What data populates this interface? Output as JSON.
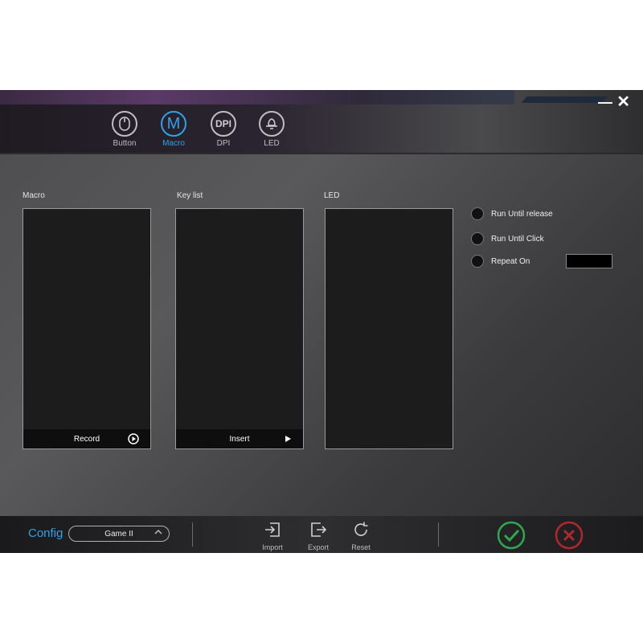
{
  "window": {
    "minimize_symbol": "—",
    "close_symbol": "✕"
  },
  "nav": {
    "tabs": [
      {
        "label": "Button",
        "icon": "mouse-icon",
        "active": false
      },
      {
        "label": "Macro",
        "icon_text": "M",
        "active": true
      },
      {
        "label": "DPI",
        "icon_text": "DPI",
        "active": false
      },
      {
        "label": "LED",
        "icon": "led-icon",
        "active": false
      }
    ]
  },
  "panels": {
    "macro": {
      "title": "Macro",
      "footer_label": "Record",
      "footer_icon": "play-circle-icon"
    },
    "keylist": {
      "title": "Key list",
      "footer_label": "Insert",
      "footer_icon": "play-icon"
    },
    "led": {
      "title": "LED"
    }
  },
  "options": [
    {
      "label": "Run Until release"
    },
    {
      "label": "Run Until Click"
    },
    {
      "label": "Repeat On"
    }
  ],
  "footer": {
    "config_label": "Config",
    "config_value": "Game II",
    "tools": [
      {
        "label": "Import",
        "icon": "import-icon"
      },
      {
        "label": "Export",
        "icon": "export-icon"
      },
      {
        "label": "Reset",
        "icon": "reset-icon"
      }
    ]
  },
  "colors": {
    "accent": "#2ea3e8",
    "ok": "#2fa84f",
    "cancel": "#b3262c"
  }
}
